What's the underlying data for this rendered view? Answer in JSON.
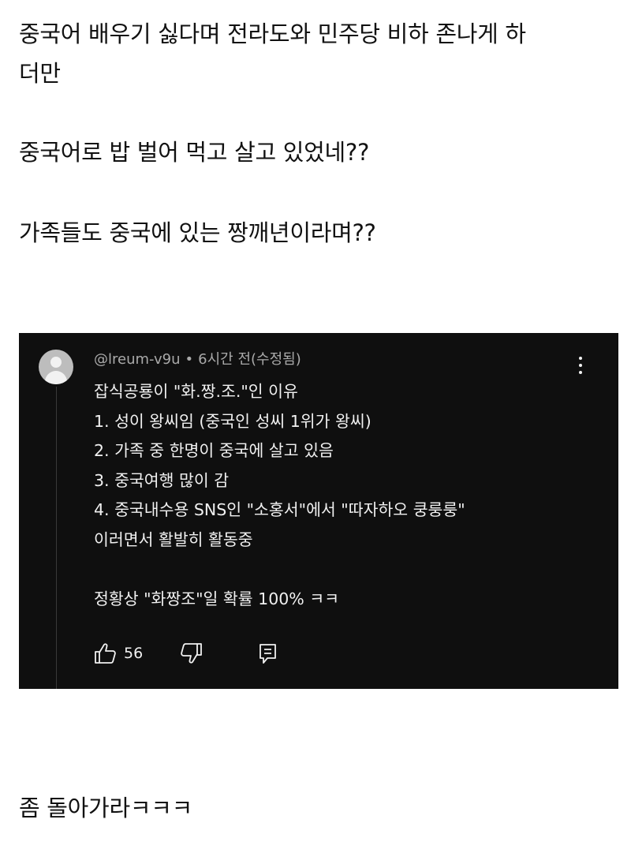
{
  "post": {
    "line1": "중국어 배우기 싫다며 전라도와 민주당 비하 존나게 하",
    "line2": "더만",
    "line3": "중국어로 밥 벌어 먹고 살고 있었네??",
    "line4": "가족들도 중국에 있는 짱깨년이라며??",
    "closing": "좀 돌아가라ㅋㅋㅋ"
  },
  "comment": {
    "author": "@lreum-v9u",
    "separator": "•",
    "time": "6시간 전(수정됨)",
    "lines": [
      "잡식공룡이 \"화.짱.조.\"인 이유",
      "1. 성이 왕씨임 (중국인 성씨 1위가 왕씨)",
      "2. 가족 중 한명이 중국에 살고 있음",
      "3. 중국여행 많이 감",
      "4. 중국내수용 SNS인 \"소홍서\"에서 \"따자하오 쿵룽룽\"",
      "이러면서 활발히 활동중",
      "",
      "정황상 \"화짱조\"일 확률 100% ㅋㅋ"
    ],
    "like_count": "56",
    "icons": {
      "avatar": "default-avatar-icon",
      "more": "kebab-menu-icon",
      "like": "thumbs-up-icon",
      "dislike": "thumbs-down-icon",
      "reply": "reply-comment-icon"
    }
  },
  "colors": {
    "page_bg": "#ffffff",
    "post_text": "#111111",
    "comment_bg": "#0f0f0f",
    "comment_text": "#f1f1f1",
    "meta_text": "#aaaaaa"
  }
}
